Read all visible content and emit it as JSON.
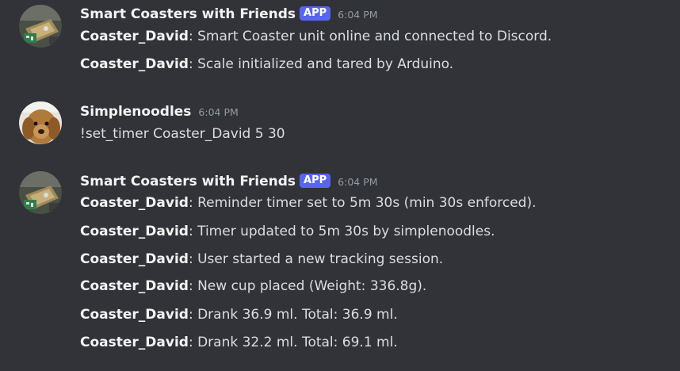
{
  "colors": {
    "background": "#313338",
    "text": "#dbdee1",
    "username": "#f2f3f5",
    "timestamp": "#949ba4",
    "app_badge": "#5865f2"
  },
  "messages": [
    {
      "author": "Smart Coasters with Friends",
      "badge": "APP",
      "time": "6:04 PM",
      "avatar_icon": "coaster-device-icon",
      "lines": [
        {
          "sender": "Coaster_David",
          "sep": ":",
          "text": " Smart Coaster unit online and connected to Discord."
        },
        {
          "sender": "Coaster_David",
          "sep": ":",
          "text": " Scale initialized and tared by Arduino."
        }
      ]
    },
    {
      "author": "Simplenoodles",
      "time": "6:04 PM",
      "avatar_icon": "dog-avatar-icon",
      "lines": [
        {
          "text": "!set_timer Coaster_David 5 30"
        }
      ]
    },
    {
      "author": "Smart Coasters with Friends",
      "badge": "APP",
      "time": "6:04 PM",
      "avatar_icon": "coaster-device-icon",
      "lines": [
        {
          "sender": "Coaster_David",
          "sep": ":",
          "text": " Reminder timer set to 5m 30s (min 30s enforced)."
        },
        {
          "sender": "Coaster_David",
          "sep": ":",
          "text": " Timer updated to 5m 30s by simplenoodles."
        },
        {
          "sender": "Coaster_David",
          "sep": ":",
          "text": " User started a new tracking session."
        },
        {
          "sender": "Coaster_David",
          "sep": ":",
          "text": " New cup placed (Weight: 336.8g)."
        },
        {
          "sender": "Coaster_David",
          "sep": ":",
          "text": " Drank 36.9 ml. Total: 36.9 ml."
        },
        {
          "sender": "Coaster_David",
          "sep": ":",
          "text": " Drank 32.2 ml. Total: 69.1 ml."
        }
      ]
    }
  ]
}
